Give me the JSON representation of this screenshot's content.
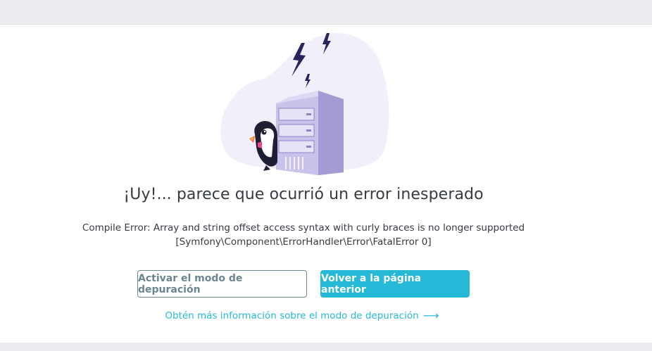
{
  "error_page": {
    "title": "¡Uy!... parece que ocurrió un error inesperado",
    "message_line1": "Compile Error: Array and string offset access syntax with curly braces is no longer supported",
    "message_line2": "[Symfony\\Component\\ErrorHandler\\Error\\FatalError 0]",
    "debug_button_label": "Activar el modo de depuración",
    "back_button_label": "Volver a la página anterior",
    "learn_more_link": "Obtén más información sobre el modo de depuración",
    "link_arrow_icon": "arrow-right-icon"
  },
  "colors": {
    "accent": "#25b9d7",
    "secondary": "#6c868e",
    "text": "#363a41",
    "server": "#c3bde8",
    "blob": "#f1eff9",
    "bolt": "#25245b"
  }
}
